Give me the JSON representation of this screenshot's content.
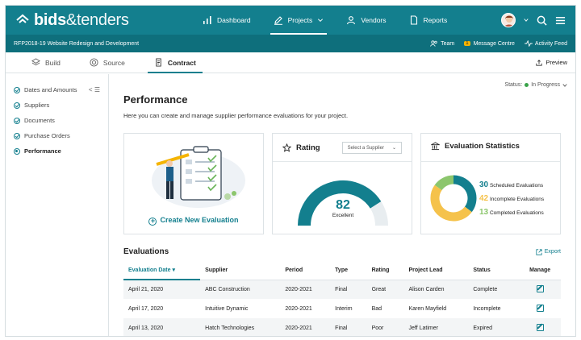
{
  "brand": {
    "bold": "bids",
    "light": "&tenders"
  },
  "topnav": [
    {
      "label": "Dashboard",
      "icon": "bar-chart-icon",
      "active": false
    },
    {
      "label": "Projects",
      "icon": "pencil-icon",
      "active": true,
      "chevron": true
    },
    {
      "label": "Vendors",
      "icon": "person-icon",
      "active": false
    },
    {
      "label": "Reports",
      "icon": "document-icon",
      "active": false
    }
  ],
  "project_title": "RFP2018-19 Website Redesign and Development",
  "subbar": {
    "team": "Team",
    "message_centre": "Message Centre",
    "message_count": "1",
    "activity_feed": "Activity Feed"
  },
  "tabs": [
    {
      "label": "Build",
      "icon": "layers-icon"
    },
    {
      "label": "Source",
      "icon": "target-icon"
    },
    {
      "label": "Contract",
      "icon": "contract-icon"
    }
  ],
  "preview_label": "Preview",
  "sidebar": [
    {
      "label": "Dates and Amounts",
      "state": "done"
    },
    {
      "label": "Suppliers",
      "state": "done"
    },
    {
      "label": "Documents",
      "state": "done"
    },
    {
      "label": "Purchase Orders",
      "state": "done"
    },
    {
      "label": "Performance",
      "state": "active"
    }
  ],
  "status": {
    "label": "Status:",
    "value": "In Progress"
  },
  "page_title": "Performance",
  "intro": "Here you can create and manage supplier performance evaluations for your project.",
  "create_label": "Create New Evaluation",
  "rating": {
    "title": "Rating",
    "select_placeholder": "Select a Supplier",
    "score": "82",
    "score_label": "Excellent",
    "fill": 0.82
  },
  "stats": {
    "title": "Evaluation Statistics",
    "items": [
      {
        "count": "30",
        "label": "Scheduled Evaluations",
        "color": "#137f8e"
      },
      {
        "count": "42",
        "label": "Incomplete Evaluations",
        "color": "#f5c24b"
      },
      {
        "count": "13",
        "label": "Completed Evaluations",
        "color": "#8cc66d"
      }
    ]
  },
  "evaluations": {
    "title": "Evaluations",
    "export_label": "Export",
    "columns": [
      "Evaluation Date",
      "Supplier",
      "Period",
      "Type",
      "Rating",
      "Project Lead",
      "Status",
      "Manage"
    ],
    "rows": [
      [
        "April 21, 2020",
        "ABC Construction",
        "2020-2021",
        "Final",
        "Great",
        "Alison Carden",
        "Complete"
      ],
      [
        "April 17, 2020",
        "Intuitive Dynamic",
        "2020-2021",
        "Interim",
        "Bad",
        "Karen Mayfield",
        "Incomplete"
      ],
      [
        "April 13, 2020",
        "Hatch Technologies",
        "2020-2021",
        "Final",
        "Poor",
        "Jeff Latimer",
        "Expired"
      ]
    ]
  },
  "colors": {
    "primary": "#137f8e",
    "subbar": "#0e6f7c",
    "status_green": "#3aa34a"
  }
}
